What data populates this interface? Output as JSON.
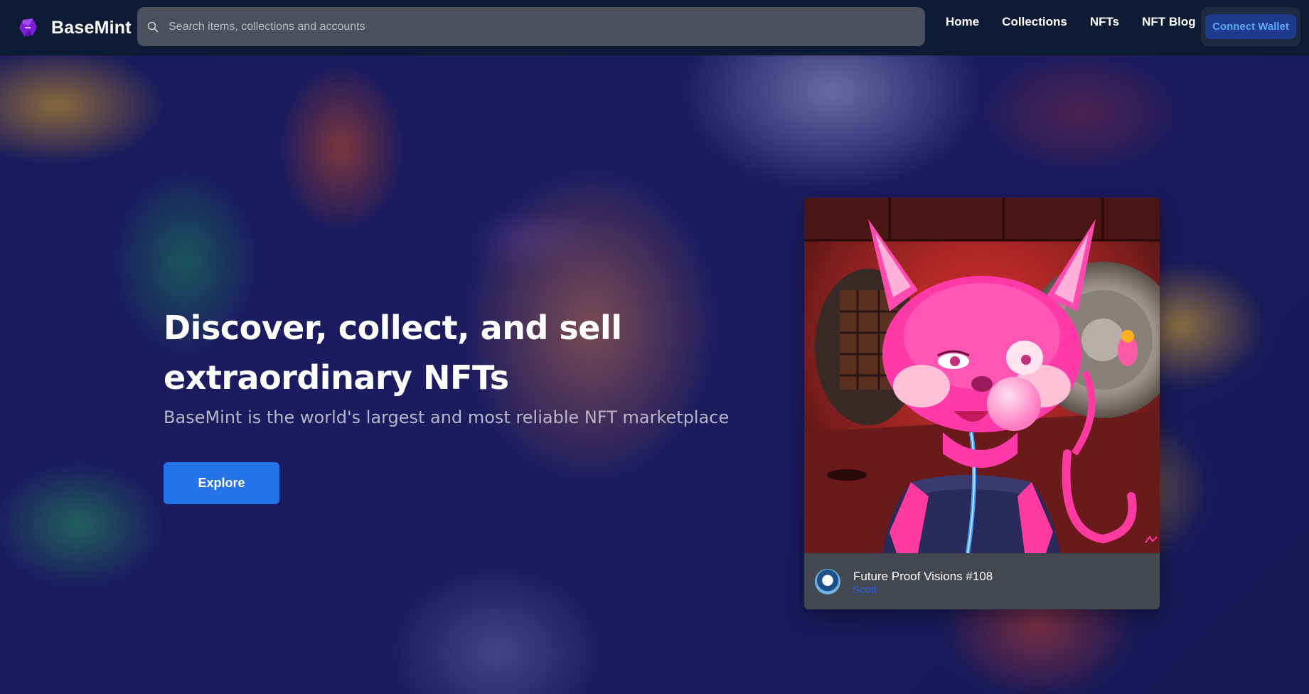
{
  "header": {
    "brand": "BaseMint",
    "search_placeholder": "Search items, collections and accounts",
    "nav": [
      "Home",
      "Collections",
      "NFTs",
      "NFT Blog"
    ],
    "wallet_label": "Connect Wallet"
  },
  "hero": {
    "headline": "Discover, collect, and sell extraordinary NFTs",
    "subheadline": "BaseMint is the world's largest and most reliable NFT marketplace",
    "cta_label": "Explore"
  },
  "featured": {
    "title": "Future Proof Visions #108",
    "author": "Scott"
  },
  "colors": {
    "nav_bg": "#0d1a33",
    "accent": "#2473e8",
    "wallet_text": "#60a5fa",
    "card_bg": "#444650"
  }
}
